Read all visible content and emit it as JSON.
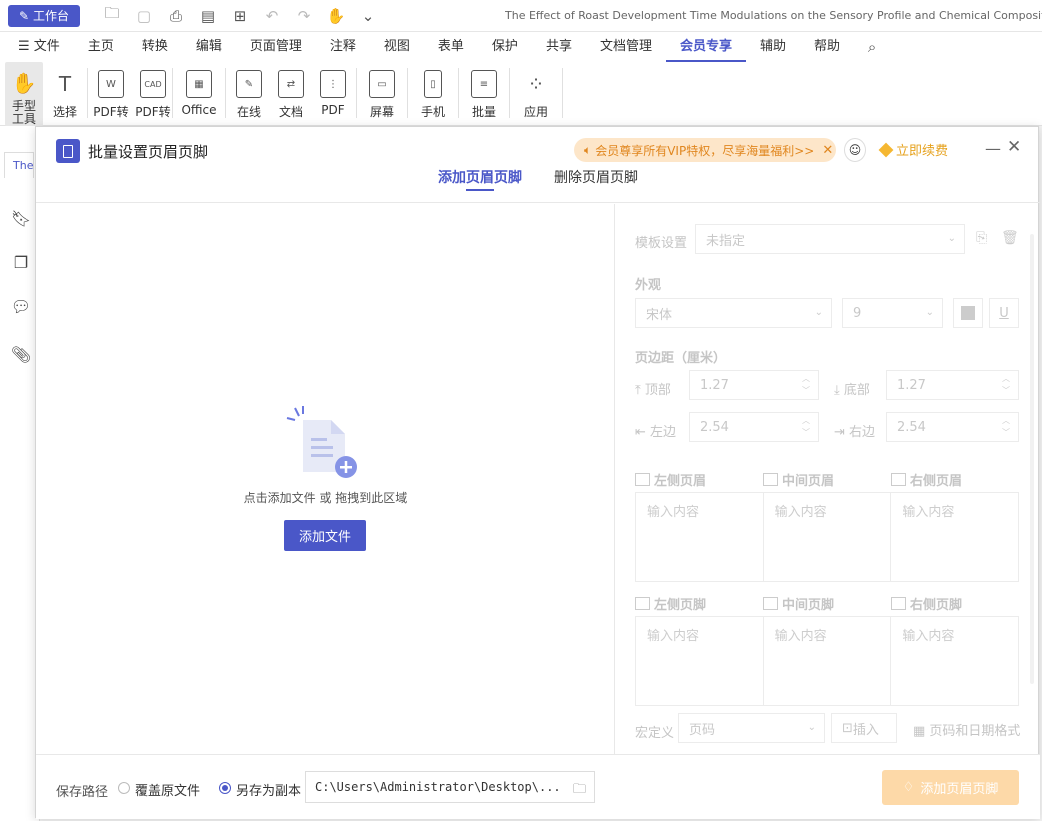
{
  "titlebar": {
    "workbench_label": "工作台",
    "document_title": "The Effect of Roast Development Time Modulations on the Sensory Profile and Chemical Composition of t"
  },
  "menubar": {
    "items": [
      "文件",
      "主页",
      "转换",
      "编辑",
      "页面管理",
      "注释",
      "视图",
      "表单",
      "保护",
      "共享",
      "文档管理",
      "会员专享",
      "辅助",
      "帮助"
    ],
    "active": "会员专享"
  },
  "ribbon": {
    "buttons": [
      {
        "line1": "手型",
        "line2": "工具"
      },
      {
        "line1": "选择"
      },
      {
        "line1": "PDF转"
      },
      {
        "line1": "PDF转"
      },
      {
        "line1": "Office"
      },
      {
        "line1": "在线"
      },
      {
        "line1": "文档"
      },
      {
        "line1": "PDF"
      },
      {
        "line1": "屏幕"
      },
      {
        "line1": "手机"
      },
      {
        "line1": "批量"
      },
      {
        "line1": "应用"
      }
    ]
  },
  "leftpanel": {
    "tab_label": "The"
  },
  "dialog": {
    "title": "批量设置页眉页脚",
    "vip_banner": "会员尊享所有VIP特权，尽享海量福利>>",
    "renew_label": "立即续费",
    "tabs": {
      "add": "添加页眉页脚",
      "remove": "删除页眉页脚"
    },
    "dropzone": {
      "hint": "点击添加文件 或 拖拽到此区域",
      "add_button": "添加文件"
    },
    "settings": {
      "template_label": "模板设置",
      "template_value": "未指定",
      "appearance_label": "外观",
      "font_value": "宋体",
      "size_value": "9",
      "margin_label": "页边距（厘米）",
      "top_label": "顶部",
      "top_value": "1.27",
      "bottom_label": "底部",
      "bottom_value": "1.27",
      "left_label": "左边",
      "left_value": "2.54",
      "right_label": "右边",
      "right_value": "2.54",
      "header_left": "左侧页眉",
      "header_center": "中间页眉",
      "header_right": "右侧页眉",
      "footer_left": "左侧页脚",
      "footer_center": "中间页脚",
      "footer_right": "右侧页脚",
      "placeholder": "输入内容",
      "custom_label": "宏定义",
      "custom_value": "页码",
      "insert_label": "插入",
      "date_format_label": "页码和日期格式"
    },
    "footer": {
      "save_path_label": "保存路径",
      "overwrite_label": "覆盖原文件",
      "copy_label": "另存为副本",
      "path_value": "C:\\Users\\Administrator\\Desktop\\...",
      "submit_label": "添加页眉页脚"
    }
  },
  "colors": {
    "accent": "#4a57c8",
    "vip": "#e0861e",
    "submit_disabled": "#fdd9a8"
  }
}
